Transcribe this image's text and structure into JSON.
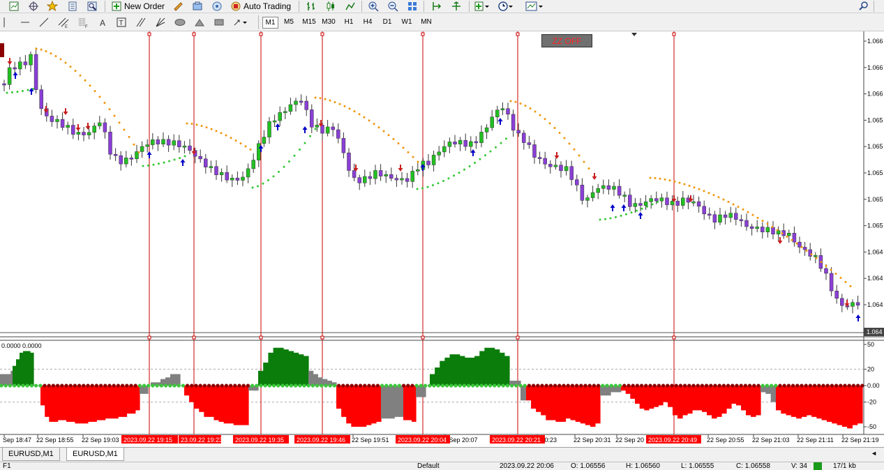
{
  "toolbar": {
    "new_order_label": "New Order",
    "auto_trading_label": "Auto Trading",
    "timeframes": [
      "M1",
      "M5",
      "M15",
      "M30",
      "H1",
      "H4",
      "D1",
      "W1",
      "MN"
    ],
    "selected_timeframe": "M1"
  },
  "chart": {
    "zz_button_label": "ZZ OFF",
    "price_labels": [
      "1.066",
      "1.066",
      "1.066",
      "1.065",
      "1.065",
      "1.065",
      "1.065",
      "1.065",
      "1.064",
      "1.064",
      "1.064"
    ],
    "current_price_label": "1.064",
    "indicator_header": "0.0000 0.0000",
    "indicator_scale": [
      "50",
      "20",
      "0.00",
      "-20",
      "-50"
    ],
    "time_labels": [
      "Sep 18:47",
      "22 Sep 18:55",
      "22 Sep 19:03",
      "22 Sep 19:51",
      "2 Sep 20:07",
      "2 20:23",
      "22 Sep 20:31",
      "22 Sep 20",
      "22 Sep 20:55",
      "22 Sep 21:03",
      "22 Sep 21:11",
      "22 Sep 21:19"
    ],
    "marker_labels": [
      "2023.09.22 19:15",
      "23.09.22 19:23",
      "2023.09.22 19:35",
      "2023.09.22 19:46",
      "2023.09.22 20:04",
      "2023.09.22 20:21",
      "2023.09.22 20:49"
    ],
    "colors": {
      "bull": "#22c022",
      "bear": "#8a3fd6",
      "sar_top": "#f0960a",
      "sar_bottom": "#32c832",
      "hist_pos": "#0a7d0a",
      "hist_neg": "#ff0000",
      "hist_neutral": "#808080",
      "marker_line": "#c80000",
      "marker_label_bg": "#ff0000"
    }
  },
  "tabs": [
    "EURUSD,M1",
    "EURUSD,M1"
  ],
  "active_tab_index": 1,
  "status": {
    "help": "F1",
    "profile": "Default",
    "datetime": "2023.09.22 20:06",
    "open": "O: 1.06556",
    "high": "H: 1.06560",
    "low": "L: 1.06555",
    "close": "C: 1.06558",
    "volume": "V: 34",
    "traffic": "17/1 kb"
  }
}
